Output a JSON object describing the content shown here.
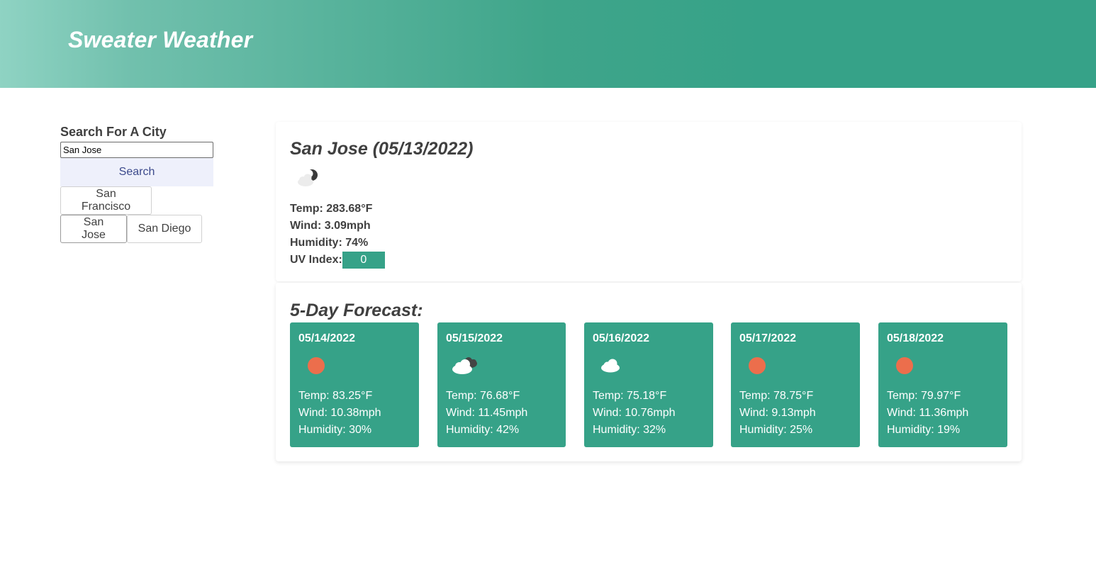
{
  "header": {
    "title": "Sweater Weather"
  },
  "search": {
    "label": "Search For A City",
    "value": "San Jose",
    "button_label": "Search",
    "history": [
      "San Francisco",
      "San Jose",
      "San Diego"
    ]
  },
  "current": {
    "title": "San Jose (05/13/2022)",
    "icon": "moon-cloud-icon",
    "temp": "Temp: 283.68°F",
    "wind": "Wind: 3.09mph",
    "humidity": "Humidity: 74%",
    "uv_label": "UV Index:",
    "uv_value": "0"
  },
  "forecast": {
    "title": "5-Day Forecast:",
    "days": [
      {
        "date": "05/14/2022",
        "icon": "sun-icon",
        "temp": "Temp: 83.25°F",
        "wind": "Wind: 10.38mph",
        "humidity": "Humidity: 30%"
      },
      {
        "date": "05/15/2022",
        "icon": "cloudy-icon",
        "temp": "Temp: 76.68°F",
        "wind": "Wind: 11.45mph",
        "humidity": "Humidity: 42%"
      },
      {
        "date": "05/16/2022",
        "icon": "cloud-icon",
        "temp": "Temp: 75.18°F",
        "wind": "Wind: 10.76mph",
        "humidity": "Humidity: 32%"
      },
      {
        "date": "05/17/2022",
        "icon": "sun-icon",
        "temp": "Temp: 78.75°F",
        "wind": "Wind: 9.13mph",
        "humidity": "Humidity: 25%"
      },
      {
        "date": "05/18/2022",
        "icon": "sun-icon",
        "temp": "Temp: 79.97°F",
        "wind": "Wind: 11.36mph",
        "humidity": "Humidity: 19%"
      }
    ]
  },
  "colors": {
    "accent": "#36a288",
    "sun": "#ec6e4c",
    "search_button_bg": "#eef0fb"
  }
}
